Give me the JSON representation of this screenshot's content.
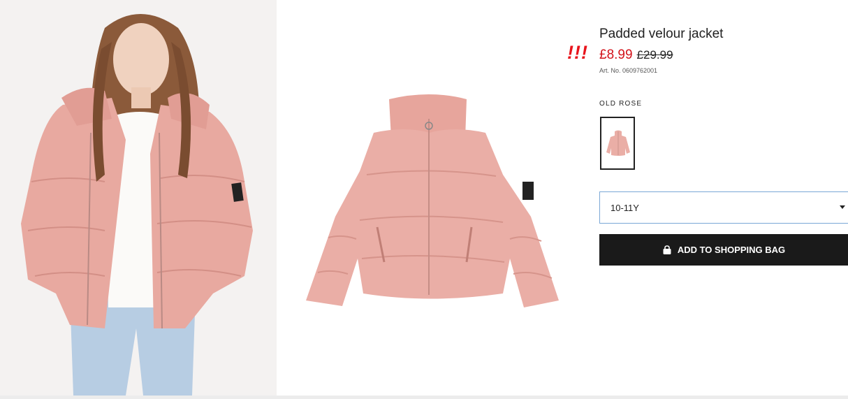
{
  "product": {
    "title": "Padded velour jacket",
    "badge": "!!!",
    "price_current": "£8.99",
    "price_original": "£29.99",
    "article": "Art. No. 0609762001",
    "color_label": "OLD ROSE"
  },
  "size_select": {
    "selected": "10-11Y"
  },
  "cta": {
    "label": "ADD TO SHOPPING BAG"
  },
  "colors": {
    "sale_red": "#d2121a",
    "jacket_pink": "#e8a9a0",
    "button_black": "#1a1a1a",
    "focus_blue": "#7aa7d6"
  }
}
